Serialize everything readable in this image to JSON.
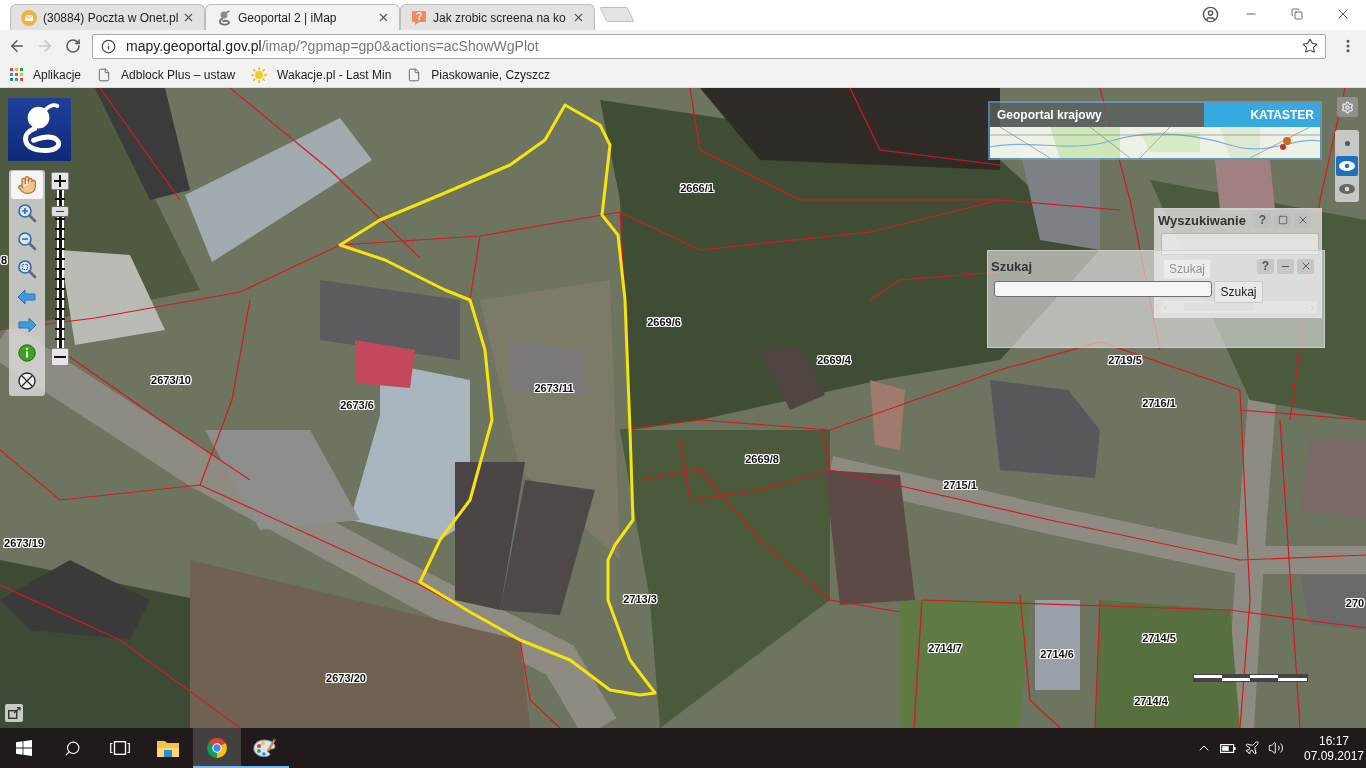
{
  "browser": {
    "tabs": [
      {
        "title": "(30884) Poczta w Onet.pl",
        "kind": "mail",
        "selected": false
      },
      {
        "title": "Geoportal 2 | iMap",
        "kind": "geoportal",
        "selected": true
      },
      {
        "title": "Jak zrobic screena na ko",
        "kind": "question",
        "selected": false
      }
    ],
    "navigation": {
      "back_disabled": false,
      "forward_disabled": true
    },
    "address_bar": {
      "host": "mapy.geoportal.gov.pl",
      "path": "/imap/?gpmap=gp0&actions=acShowWgPlot"
    },
    "bookmarks": [
      {
        "label": "Aplikacje",
        "kind": "apps"
      },
      {
        "label": "Adblock Plus – ustaw",
        "kind": "page"
      },
      {
        "label": "Wakacje.pl - Last Min",
        "kind": "sun"
      },
      {
        "label": "Piaskowanie, Czyszcz",
        "kind": "page"
      }
    ]
  },
  "map": {
    "banner": {
      "title": "Geoportal krajowy",
      "layer": "KATASTER"
    },
    "tools": [
      {
        "kind": "pan",
        "selected": true
      },
      {
        "kind": "zoom_in",
        "selected": false
      },
      {
        "kind": "zoom_out",
        "selected": false
      },
      {
        "kind": "zoom_extent",
        "selected": false
      },
      {
        "kind": "back",
        "selected": false
      },
      {
        "kind": "forward",
        "selected": false
      },
      {
        "kind": "info",
        "selected": false
      },
      {
        "kind": "clear",
        "selected": false
      }
    ],
    "zoom_slider": {
      "level": 0.89
    },
    "view_modes": [
      {
        "kind": "dot",
        "selected": false
      },
      {
        "kind": "eye",
        "selected": true
      },
      {
        "kind": "eye",
        "selected": false
      }
    ],
    "parcel_labels": [
      "2666/1",
      "8",
      "2669/6",
      "2669/4",
      "2719/5",
      "2673/10",
      "2673/11",
      "2716/1",
      "2673/6",
      "2669/8",
      "2715/1",
      "2673/19",
      "2713/3",
      "270",
      "2714/5",
      "2714/7",
      "2714/6",
      "2673/20",
      "2714/4"
    ],
    "search_panel": {
      "title": "Wyszukiwanie",
      "controls": [
        {
          "kind": "help",
          "label": "?"
        },
        {
          "kind": "maximize"
        },
        {
          "kind": "close"
        }
      ],
      "button": "Szukaj"
    },
    "search_dialog": {
      "title": "Szukaj",
      "controls": [
        {
          "kind": "help",
          "label": "?"
        },
        {
          "kind": "minimize"
        },
        {
          "kind": "close"
        }
      ],
      "button": "Szukaj"
    }
  },
  "taskbar": {
    "apps": [
      {
        "kind": "explorer",
        "running": false,
        "selected": false
      },
      {
        "kind": "chrome",
        "running": true,
        "selected": true
      },
      {
        "kind": "paint",
        "running": true,
        "selected": false
      }
    ],
    "time": "16:17",
    "date": "07.09.2017"
  }
}
